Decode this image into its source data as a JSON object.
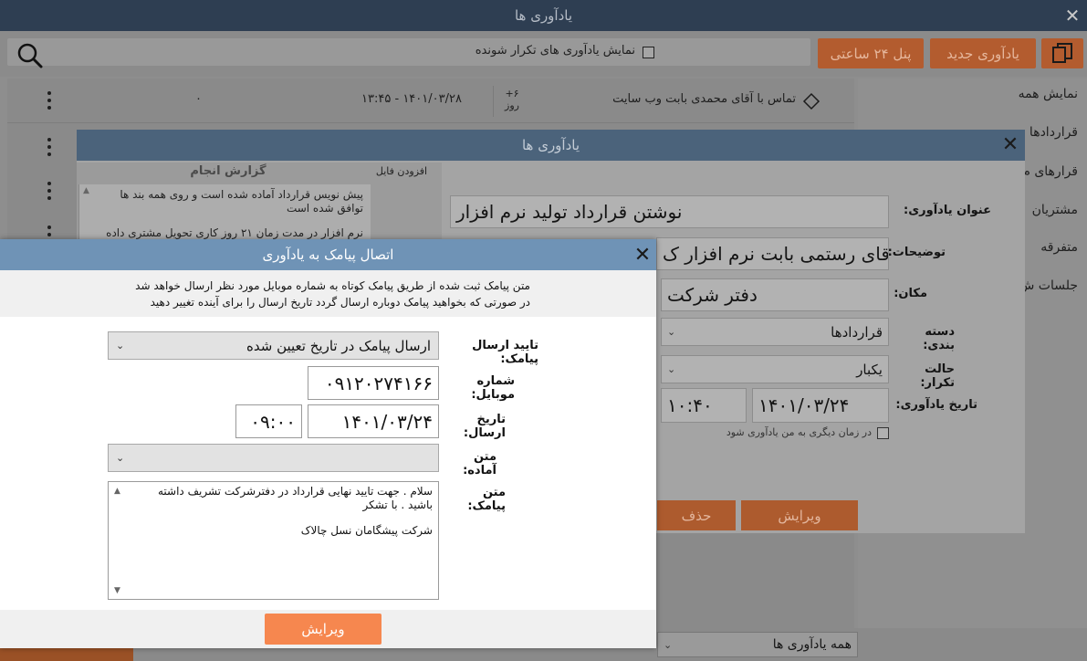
{
  "main": {
    "title": "یادآوری ها",
    "toolbar": {
      "show_repeating_label": "نمایش یادآوری های تکرار شونده",
      "panel_button": "پنل ۲۴ ساعتی",
      "new_button": "یادآوری جدید"
    },
    "list": {
      "first_row": {
        "title": "تماس با آقای محمدی بابت وب سایت",
        "days_value": "+۶",
        "days_unit": "روز",
        "datetime": "۱۴۰۱/۰۳/۲۸ - ۱۳:۴۵",
        "count": "۰"
      }
    },
    "sidebar": {
      "items": [
        "نمایش همه",
        "قراردادها",
        "قرارهای م",
        "مشتریان",
        "متفرقه",
        "جلسات ش"
      ]
    },
    "bottom": {
      "filter_value": "همه یادآوری ها"
    }
  },
  "reminder_dialog": {
    "title": "یادآوری ها",
    "report_title": "گزارش انجام",
    "add_file": "افزودن فایل",
    "report_lines": [
      "پیش نویس قرارداد آماده شده است و روی همه بند ها",
      "توافق شده است",
      "نرم افزار در مدت زمان ۲۱ روز کاری تحویل مشتری داده"
    ],
    "fields": {
      "title_label": "عنوان یادآوری:",
      "title_value": "نوشتن قرارداد تولید نرم افزار",
      "desc_label": "توضیحات:",
      "desc_value": "آقای رستمی بابت نرم افزار ک",
      "place_label": "مکان:",
      "place_value": "دفتر شرکت",
      "category_label": "دسته بندی:",
      "category_value": "قراردادها",
      "repeat_label": "حالت تکرار:",
      "repeat_value": "یکبار",
      "date_label": "تاریخ یادآوری:",
      "date_value": "۱۴۰۱/۰۳/۲۴",
      "time_value": "۱۰:۴۰",
      "other_time_label": "در زمان دیگری به من یادآوری شود"
    },
    "edit_button": "ویرایش",
    "delete_button": "حذف"
  },
  "sms_dialog": {
    "title": "اتصال پیامک به یادآوری",
    "info_lines": [
      "متن پیامک ثبت شده از طریق پیامک کوتاه به شماره موبایل مورد نظر ارسال خواهد شد",
      "در صورتی که بخواهید پیامک دوباره ارسال گردد تاریخ ارسال را برای آینده تغییر دهید"
    ],
    "confirm_label": "تایید ارسال پیامک:",
    "confirm_value": "ارسال پیامک در تاریخ تعیین شده",
    "mobile_label": "شماره موبایل:",
    "mobile_value": "۰۹۱۲۰۲۷۴۱۶۶",
    "send_date_label": "تاریخ ارسال:",
    "send_date_value": "۱۴۰۱/۰۳/۲۴",
    "send_time_value": "۰۹:۰۰",
    "preset_label": "متن آماده:",
    "preset_value": "",
    "text_label": "متن پیامک:",
    "text_lines": [
      "سلام . جهت تایید نهایی قرارداد در دفترشرکت تشریف داشته",
      "باشید . با تشکر",
      "",
      "شرکت پیشگامان نسل چالاک"
    ],
    "edit_button": "ویرایش"
  }
}
